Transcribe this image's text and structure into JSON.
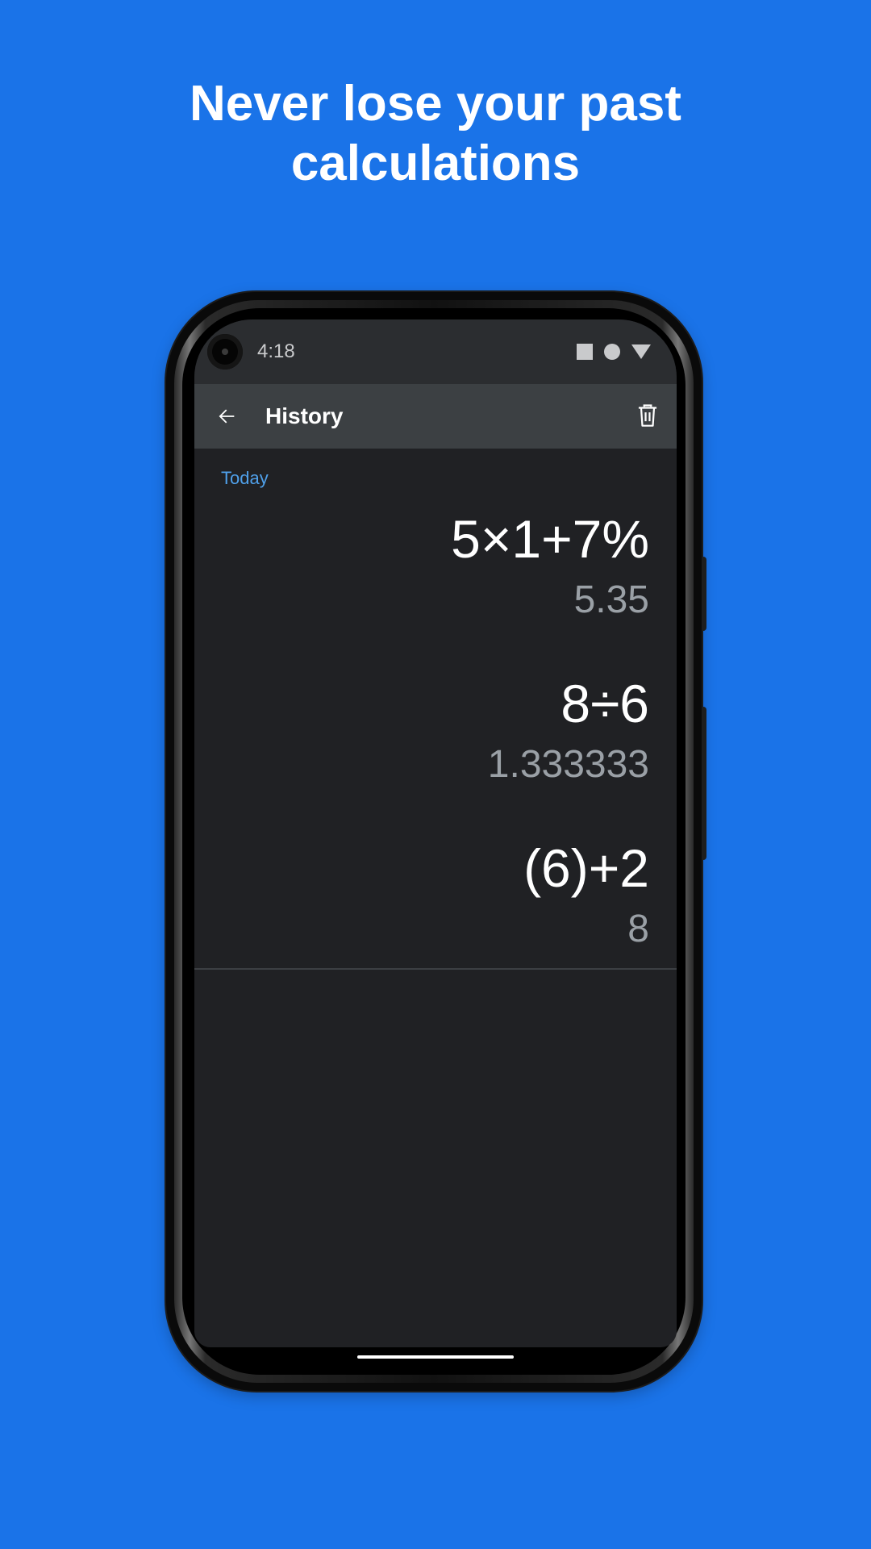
{
  "headline": {
    "line1": "Never lose your past",
    "line2": "calculations"
  },
  "status_bar": {
    "time": "4:18"
  },
  "app_bar": {
    "title": "History"
  },
  "history": {
    "section_label": "Today",
    "entries": [
      {
        "expression": "5×1+7%",
        "result": "5.35"
      },
      {
        "expression": "8÷6",
        "result": "1.333333"
      },
      {
        "expression": "(6)+2",
        "result": "8"
      }
    ]
  },
  "colors": {
    "background": "#1a73e8",
    "screen": "#202124",
    "app_bar": "#3c4043",
    "section_label": "#4fa0ea",
    "result_text": "#9aa0a6"
  }
}
